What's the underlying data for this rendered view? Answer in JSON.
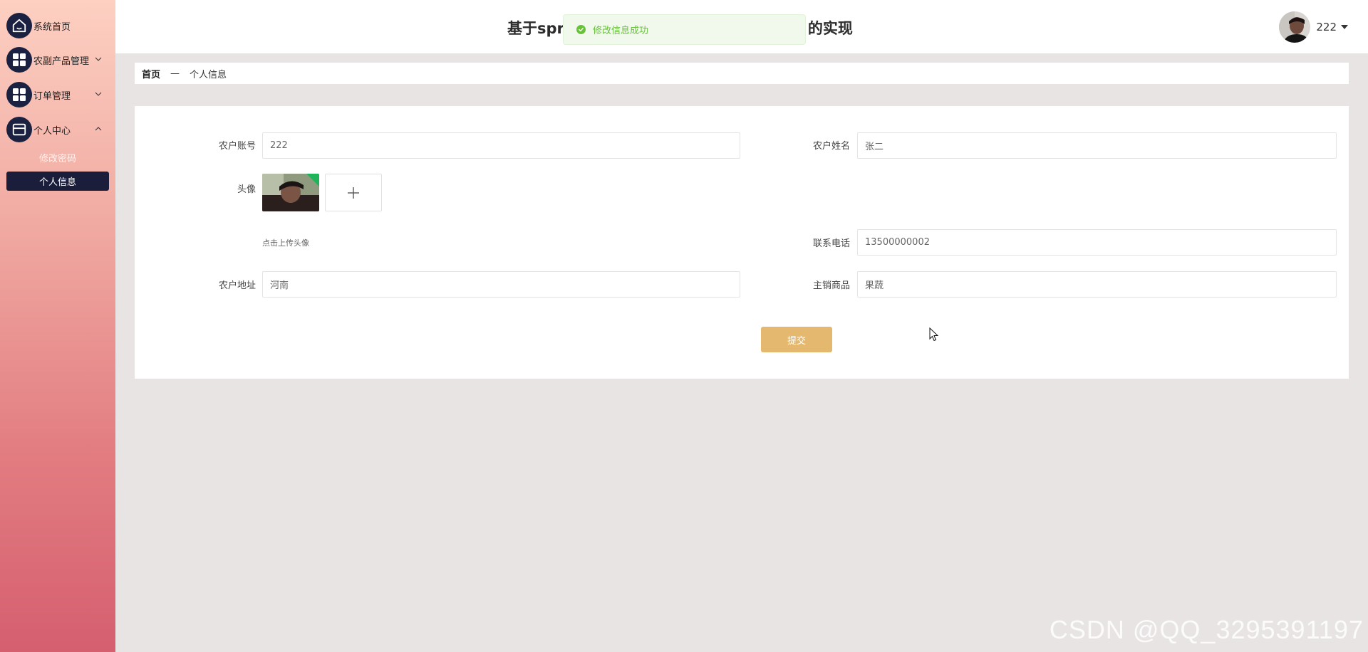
{
  "sidebar": {
    "items": [
      {
        "label": "系统首页",
        "icon": "home-icon"
      },
      {
        "label": "农副产品管理",
        "icon": "grid-icon",
        "expanded": false
      },
      {
        "label": "订单管理",
        "icon": "grid-icon",
        "expanded": false
      },
      {
        "label": "个人中心",
        "icon": "card-icon",
        "expanded": true,
        "children": [
          {
            "label": "修改密码",
            "active": false
          },
          {
            "label": "个人信息",
            "active": true
          }
        ]
      }
    ],
    "colors": {
      "gradient_top": "#fdd0c2",
      "gradient_bottom": "#d55f6f",
      "icon_bg": "#1b2140",
      "active_bg": "#1b1e3a"
    }
  },
  "header": {
    "title_left": "基于spr",
    "title_right": "的实现",
    "user_name": "222"
  },
  "toast": {
    "message": "修改信息成功",
    "type": "success",
    "color": "#67c23a"
  },
  "breadcrumb": {
    "home": "首页",
    "separator": "—",
    "current": "个人信息"
  },
  "form": {
    "account": {
      "label": "农户账号",
      "value": "222"
    },
    "name": {
      "label": "农户姓名",
      "value": "张二"
    },
    "avatar": {
      "label": "头像",
      "upload_tip": "点击上传头像"
    },
    "phone": {
      "label": "联系电话",
      "value": "13500000002"
    },
    "address": {
      "label": "农户地址",
      "value": "河南"
    },
    "product": {
      "label": "主销商品",
      "value": "果蔬"
    },
    "submit_label": "提交",
    "submit_color": "#e4b86f"
  },
  "watermark": "CSDN @QQ_3295391197"
}
